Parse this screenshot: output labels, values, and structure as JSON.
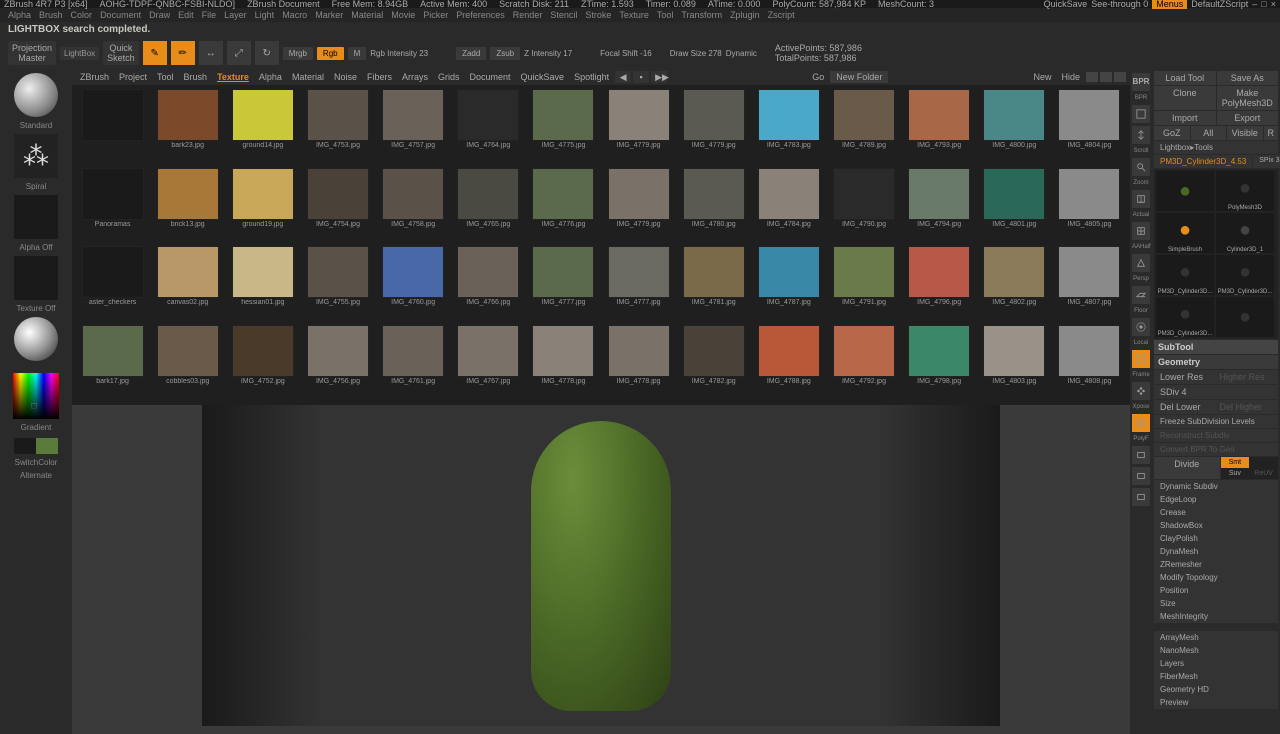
{
  "title_bar": {
    "app": "ZBrush 4R7 P3 [x64]",
    "doc_id": "AOHG-TDPF-QNBC-FSBI-NLDO]",
    "doc_name": "ZBrush Document",
    "free_mem": "Free Mem: 8.94GB",
    "active_mem": "Active Mem: 400",
    "scratch": "Scratch Disk: 211",
    "ztime": "ZTime: 1.593",
    "timer": "Timer: 0.089",
    "atime": "ATime: 0.000",
    "polycount": "PolyCount: 587,984 KP",
    "meshcount": "MeshCount: 3",
    "quicksave": "QuickSave",
    "seethrough": "See-through  0",
    "menus": "Menus",
    "script": "DefaultZScript"
  },
  "menubar": [
    "Alpha",
    "Brush",
    "Color",
    "Document",
    "Draw",
    "Edit",
    "File",
    "Layer",
    "Light",
    "Macro",
    "Marker",
    "Material",
    "Movie",
    "Picker",
    "Preferences",
    "Render",
    "Stencil",
    "Stroke",
    "Texture",
    "Tool",
    "Transform",
    "Zplugin",
    "Zscript"
  ],
  "status": "LIGHTBOX search completed.",
  "toolbar2": {
    "proj_master": "Projection\nMaster",
    "lightbox": "LightBox",
    "quick_sketch": "Quick\nSketch",
    "edit": "Edit",
    "draw": "Draw",
    "move": "Move",
    "scale": "Scale",
    "rotate": "Rotate",
    "mrgb": "Mrgb",
    "rgb": "Rgb",
    "m": "M",
    "rgb_int": "Rgb Intensity 23",
    "zadd": "Zadd",
    "zsub": "Zsub",
    "z_int": "Z Intensity 17",
    "focal": "Focal Shift -16",
    "draw_size": "Draw Size 278",
    "dynamic": "Dynamic",
    "active_pts": "ActivePoints: 587,986",
    "total_pts": "TotalPoints: 587,986"
  },
  "left": {
    "brush": "Standard",
    "stroke": "Spiral",
    "alpha": "Alpha Off",
    "texture": "Texture Off",
    "material": "",
    "gradient": "Gradient",
    "switch": "SwitchColor",
    "alternate": "Alternate"
  },
  "browser": {
    "tabs": [
      "ZBrush",
      "Project",
      "Tool",
      "Brush",
      "Texture",
      "Alpha",
      "Material",
      "Noise",
      "Fibers",
      "Arrays",
      "Grids",
      "Document",
      "QuickSave",
      "Spotlight"
    ],
    "active": "Texture",
    "go": "Go",
    "new_folder": "New Folder",
    "new": "New",
    "hide": "Hide"
  },
  "textures": [
    {
      "n": "",
      "c": "#1a1a1a"
    },
    {
      "n": "bark23.jpg",
      "c": "#7a4a2a"
    },
    {
      "n": "ground14.jpg",
      "c": "#c8c838"
    },
    {
      "n": "IMG_4753.jpg",
      "c": "#5a5248"
    },
    {
      "n": "IMG_4757.jpg",
      "c": "#6a6258"
    },
    {
      "n": "IMG_4764.jpg",
      "c": "#2a2a2a"
    },
    {
      "n": "IMG_4775.jpg",
      "c": "#5a6a4a"
    },
    {
      "n": "IMG_4779.jpg",
      "c": "#8a8278"
    },
    {
      "n": "IMG_4779.jpg",
      "c": "#5a5a52"
    },
    {
      "n": "IMG_4783.jpg",
      "c": "#4aa8c8"
    },
    {
      "n": "IMG_4789.jpg",
      "c": "#6a5a4a"
    },
    {
      "n": "IMG_4793.jpg",
      "c": "#a86848"
    },
    {
      "n": "IMG_4800.jpg",
      "c": "#4a8888"
    },
    {
      "n": "IMG_4804.jpg",
      "c": "#8a8a8a"
    },
    {
      "n": "Panoramas",
      "c": "#1a1a1a"
    },
    {
      "n": "brick13.jpg",
      "c": "#a87838"
    },
    {
      "n": "ground19.jpg",
      "c": "#c8a858"
    },
    {
      "n": "IMG_4754.jpg",
      "c": "#4a4238"
    },
    {
      "n": "IMG_4758.jpg",
      "c": "#5a5248"
    },
    {
      "n": "IMG_4765.jpg",
      "c": "#4a4a42"
    },
    {
      "n": "IMG_4776.jpg",
      "c": "#5a6a4a"
    },
    {
      "n": "IMG_4779.jpg",
      "c": "#7a7268"
    },
    {
      "n": "IMG_4780.jpg",
      "c": "#5a5a52"
    },
    {
      "n": "IMG_4784.jpg",
      "c": "#8a8278"
    },
    {
      "n": "IMG_4790.jpg",
      "c": "#2a2a2a"
    },
    {
      "n": "IMG_4794.jpg",
      "c": "#6a7a6a"
    },
    {
      "n": "IMG_4801.jpg",
      "c": "#2a6858"
    },
    {
      "n": "IMG_4805.jpg",
      "c": "#8a8a8a"
    },
    {
      "n": "aster_checkers",
      "c": "#1a1a1a"
    },
    {
      "n": "canvas02.jpg",
      "c": "#b89868"
    },
    {
      "n": "hessian01.jpg",
      "c": "#c8b888"
    },
    {
      "n": "IMG_4755.jpg",
      "c": "#5a5248"
    },
    {
      "n": "IMG_4760.jpg",
      "c": "#4868a8"
    },
    {
      "n": "IMG_4766.jpg",
      "c": "#6a6258"
    },
    {
      "n": "IMG_4777.jpg",
      "c": "#5a6a4a"
    },
    {
      "n": "IMG_4777.jpg",
      "c": "#6a6a62"
    },
    {
      "n": "IMG_4781.jpg",
      "c": "#7a6a4a"
    },
    {
      "n": "IMG_4787.jpg",
      "c": "#3888a8"
    },
    {
      "n": "IMG_4791.jpg",
      "c": "#6a7a4a"
    },
    {
      "n": "IMG_4796.jpg",
      "c": "#b85848"
    },
    {
      "n": "IMG_4802.jpg",
      "c": "#8a7a5a"
    },
    {
      "n": "IMG_4807.jpg",
      "c": "#8a8a8a"
    },
    {
      "n": "bark17.jpg",
      "c": "#5a6a4a"
    },
    {
      "n": "cobbles03.jpg",
      "c": "#6a5a4a"
    },
    {
      "n": "IMG_4752.jpg",
      "c": "#4a3a2a"
    },
    {
      "n": "IMG_4756.jpg",
      "c": "#7a7268"
    },
    {
      "n": "IMG_4761.jpg",
      "c": "#6a6258"
    },
    {
      "n": "IMG_4767.jpg",
      "c": "#7a7268"
    },
    {
      "n": "IMG_4778.jpg",
      "c": "#8a8278"
    },
    {
      "n": "IMG_4778.jpg",
      "c": "#7a7268"
    },
    {
      "n": "IMG_4782.jpg",
      "c": "#4a4238"
    },
    {
      "n": "IMG_4788.jpg",
      "c": "#b85838"
    },
    {
      "n": "IMG_4792.jpg",
      "c": "#b86848"
    },
    {
      "n": "IMG_4798.jpg",
      "c": "#3a8868"
    },
    {
      "n": "IMG_4803.jpg",
      "c": "#9a9288"
    },
    {
      "n": "IMG_4808.jpg",
      "c": "#8a8a8a"
    }
  ],
  "mid_icons": [
    "BPR",
    "",
    "Scroll",
    "Zoom",
    "Actual",
    "AAHalf",
    "Persp",
    "Floor",
    "Local",
    "Frame",
    "Xpose",
    "PolyF"
  ],
  "right": {
    "load_tool": "Load Tool",
    "save_as": "Save As",
    "clone": "Clone",
    "make_poly": "Make PolyMesh3D",
    "import": "Import",
    "export": "Export",
    "goz": "GoZ",
    "all": "All",
    "visible": "Visible",
    "r": "R",
    "lightbox_tools": "Lightbox▸Tools",
    "current_tool": "PM3D_Cylinder3D_4.53",
    "spix": "SPix 3",
    "tools": [
      {
        "n": "",
        "c": "#4a6825"
      },
      {
        "n": "PolyMesh3D",
        "c": "#333"
      },
      {
        "n": "SimpleBrush",
        "c": "#e88c1a"
      },
      {
        "n": "Cylinder3D_1",
        "c": "#444"
      },
      {
        "n": "PM3D_Cylinder3D...",
        "c": "#333"
      },
      {
        "n": "PM3D_Cylinder3D...",
        "c": "#333"
      },
      {
        "n": "PM3D_Cylinder3D...",
        "c": "#333"
      },
      {
        "n": "",
        "c": "#333"
      }
    ],
    "subtool": "SubTool",
    "geometry": "Geometry",
    "lower_res": "Lower Res",
    "higher_res": "Higher Res",
    "sdiv": "SDiv 4",
    "sdiv_max": "",
    "del_lower": "Del Lower",
    "del_higher": "Del Higher",
    "freeze": "Freeze SubDivision Levels",
    "reconstruct": "Reconstruct Subdiv",
    "convert": "Convert BPR To Geo",
    "divide": "Divide",
    "smt": "Smt",
    "suv": "Suv",
    "rebuild": "ReUV",
    "sections": [
      "Dynamic Subdiv",
      "EdgeLoop",
      "Crease",
      "ShadowBox",
      "ClayPolish",
      "DynaMesh",
      "ZRemesher",
      "Modify Topology",
      "Position",
      "Size",
      "MeshIntegrity"
    ],
    "sections2": [
      "ArrayMesh",
      "NanoMesh",
      "Layers",
      "FiberMesh",
      "Geometry HD",
      "Preview"
    ]
  }
}
